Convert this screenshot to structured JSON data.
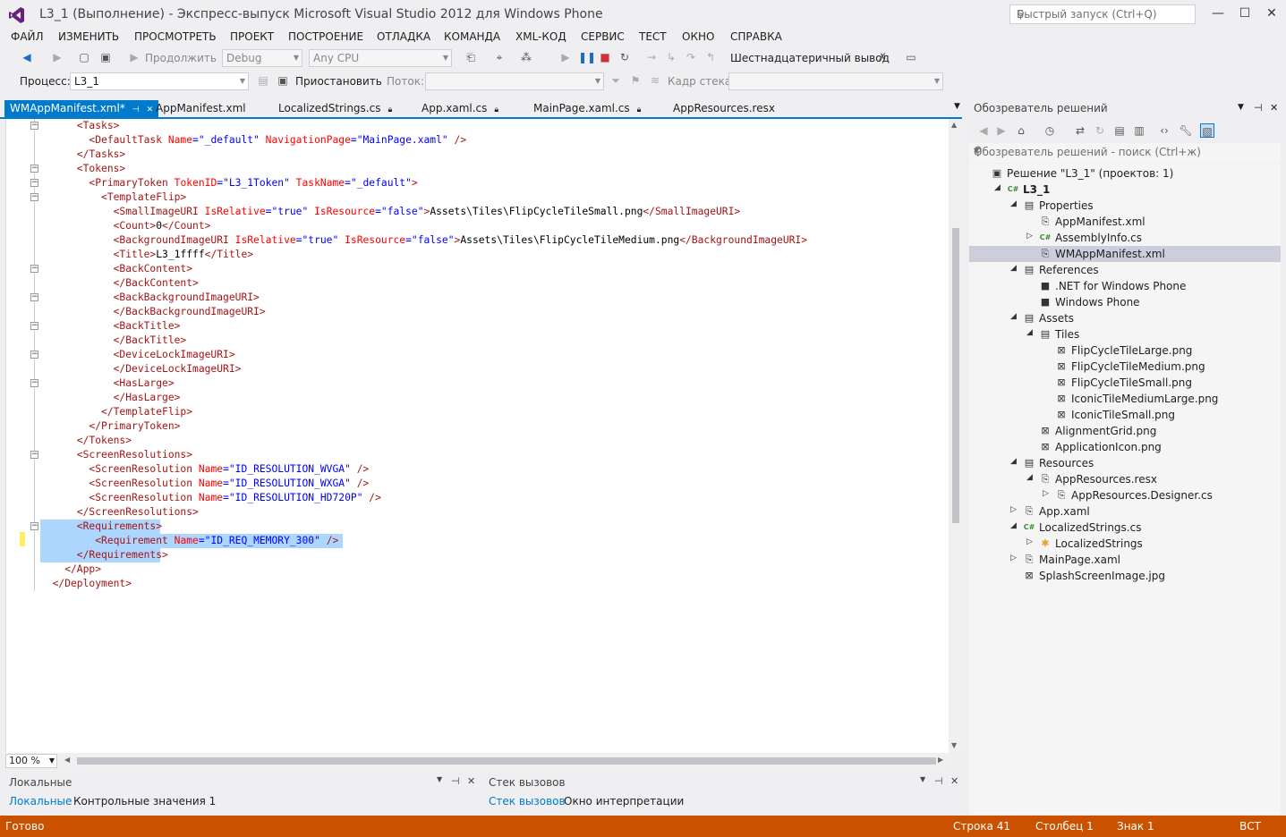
{
  "window": {
    "title": "L3_1 (Выполнение) - Экспресс-выпуск Microsoft Visual Studio 2012 для Windows Phone",
    "quick_launch_placeholder": "Быстрый запуск (Ctrl+Q)"
  },
  "menu": [
    "ФАЙЛ",
    "ИЗМЕНИТЬ",
    "ПРОСМОТРЕТЬ",
    "ПРОЕКТ",
    "ПОСТРОЕНИЕ",
    "ОТЛАДКА",
    "КОМАНДА",
    "XML-КОД",
    "СЕРВИС",
    "ТЕСТ",
    "ОКНО",
    "СПРАВКА"
  ],
  "toolbar": {
    "continue_label": "Продолжить",
    "config": "Debug",
    "platform": "Any CPU",
    "hex_label": "Шестнадцатеричный вывод",
    "process_label": "Процесс:",
    "process_value": "L3_1",
    "suspend_label": "Приостановить",
    "thread_label": "Поток:",
    "stack_frame_label": "Кадр стека:"
  },
  "tabs": [
    {
      "label": "WMAppManifest.xml*"
    },
    {
      "label": "AppManifest.xml"
    },
    {
      "label": "LocalizedStrings.cs"
    },
    {
      "label": "App.xaml.cs"
    },
    {
      "label": "MainPage.xaml.cs"
    },
    {
      "label": "AppResources.resx"
    }
  ],
  "editor": {
    "zoom": "100 %",
    "lines": [
      [
        [
          "t",
          "      <Tasks>"
        ]
      ],
      [
        [
          "t",
          "        <DefaultTask "
        ],
        [
          "a",
          "Name"
        ],
        [
          "b",
          "=\"_default\" "
        ],
        [
          "a",
          "NavigationPage"
        ],
        [
          "b",
          "=\"MainPage.xaml\" "
        ],
        [
          "t",
          "/>"
        ]
      ],
      [
        [
          "t",
          "      </Tasks>"
        ]
      ],
      [
        [
          "t",
          "      <Tokens>"
        ]
      ],
      [
        [
          "t",
          "        <PrimaryToken "
        ],
        [
          "a",
          "TokenID"
        ],
        [
          "b",
          "=\"L3_1Token\" "
        ],
        [
          "a",
          "TaskName"
        ],
        [
          "b",
          "=\"_default\""
        ],
        [
          "t",
          ">"
        ]
      ],
      [
        [
          "t",
          "          <TemplateFlip>"
        ]
      ],
      [
        [
          "t",
          "            <SmallImageURI "
        ],
        [
          "a",
          "IsRelative"
        ],
        [
          "b",
          "=\"true\" "
        ],
        [
          "a",
          "IsResource"
        ],
        [
          "b",
          "=\"false\""
        ],
        [
          "t",
          ">"
        ],
        [
          "k",
          "Assets\\Tiles\\FlipCycleTileSmall.png"
        ],
        [
          "t",
          "</SmallImageURI>"
        ]
      ],
      [
        [
          "t",
          "            <Count>"
        ],
        [
          "k",
          "0"
        ],
        [
          "t",
          "</Count>"
        ]
      ],
      [
        [
          "t",
          "            <BackgroundImageURI "
        ],
        [
          "a",
          "IsRelative"
        ],
        [
          "b",
          "=\"true\" "
        ],
        [
          "a",
          "IsResource"
        ],
        [
          "b",
          "=\"false\""
        ],
        [
          "t",
          ">"
        ],
        [
          "k",
          "Assets\\Tiles\\FlipCycleTileMedium.png"
        ],
        [
          "t",
          "</BackgroundImageURI>"
        ]
      ],
      [
        [
          "t",
          "            <Title>"
        ],
        [
          "k",
          "L3_1ffff"
        ],
        [
          "t",
          "</Title>"
        ]
      ],
      [
        [
          "t",
          "            <BackContent>"
        ]
      ],
      [
        [
          "t",
          "            </BackContent>"
        ]
      ],
      [
        [
          "t",
          "            <BackBackgroundImageURI>"
        ]
      ],
      [
        [
          "t",
          "            </BackBackgroundImageURI>"
        ]
      ],
      [
        [
          "t",
          "            <BackTitle>"
        ]
      ],
      [
        [
          "t",
          "            </BackTitle>"
        ]
      ],
      [
        [
          "t",
          "            <DeviceLockImageURI>"
        ]
      ],
      [
        [
          "t",
          "            </DeviceLockImageURI>"
        ]
      ],
      [
        [
          "t",
          "            <HasLarge>"
        ]
      ],
      [
        [
          "t",
          "            </HasLarge>"
        ]
      ],
      [
        [
          "t",
          "          </TemplateFlip>"
        ]
      ],
      [
        [
          "t",
          "        </PrimaryToken>"
        ]
      ],
      [
        [
          "t",
          "      </Tokens>"
        ]
      ],
      [
        [
          "t",
          "      <ScreenResolutions>"
        ]
      ],
      [
        [
          "t",
          "        <ScreenResolution "
        ],
        [
          "a",
          "Name"
        ],
        [
          "b",
          "=\"ID_RESOLUTION_WVGA\" "
        ],
        [
          "t",
          "/>"
        ]
      ],
      [
        [
          "t",
          "        <ScreenResolution "
        ],
        [
          "a",
          "Name"
        ],
        [
          "b",
          "=\"ID_RESOLUTION_WXGA\" "
        ],
        [
          "t",
          "/>"
        ]
      ],
      [
        [
          "t",
          "        <ScreenResolution "
        ],
        [
          "a",
          "Name"
        ],
        [
          "b",
          "=\"ID_RESOLUTION_HD720P\" "
        ],
        [
          "t",
          "/>"
        ]
      ],
      [
        [
          "t",
          "      </ScreenResolutions>"
        ]
      ],
      [
        [
          "t",
          "      <Requirements>"
        ]
      ],
      [
        [
          "t",
          "         <Requirement "
        ],
        [
          "a",
          "Name"
        ],
        [
          "b",
          "=\"ID_REQ_MEMORY_300\" "
        ],
        [
          "t",
          "/>"
        ]
      ],
      [
        [
          "t",
          "      </Requirements>"
        ]
      ],
      [
        [
          "t",
          "    </App>"
        ]
      ],
      [
        [
          "t",
          "  </Deployment>"
        ]
      ]
    ]
  },
  "solution_explorer": {
    "title": "Обозреватель решений",
    "search_placeholder": "Обозреватель решений - поиск (Ctrl+ж)",
    "nodes": [
      {
        "label": "Решение \"L3_1\"  (проектов: 1)",
        "depth": 0,
        "exp": "",
        "icon": "▣"
      },
      {
        "label": "L3_1",
        "depth": 1,
        "exp": "◢",
        "icon": "C#",
        "bold": true
      },
      {
        "label": "Properties",
        "depth": 2,
        "exp": "◢",
        "icon": "▤"
      },
      {
        "label": "AppManifest.xml",
        "depth": 3,
        "exp": "",
        "icon": "⎘"
      },
      {
        "label": "AssemblyInfo.cs",
        "depth": 3,
        "exp": "▷",
        "icon": "C#"
      },
      {
        "label": "WMAppManifest.xml",
        "depth": 3,
        "exp": "",
        "icon": "⎘",
        "selected": true
      },
      {
        "label": "References",
        "depth": 2,
        "exp": "◢",
        "icon": "▤"
      },
      {
        "label": ".NET for Windows Phone",
        "depth": 3,
        "exp": "",
        "icon": "■"
      },
      {
        "label": "Windows Phone",
        "depth": 3,
        "exp": "",
        "icon": "■"
      },
      {
        "label": "Assets",
        "depth": 2,
        "exp": "◢",
        "icon": "▤"
      },
      {
        "label": "Tiles",
        "depth": 3,
        "exp": "◢",
        "icon": "▤"
      },
      {
        "label": "FlipCycleTileLarge.png",
        "depth": 4,
        "exp": "",
        "icon": "⊠"
      },
      {
        "label": "FlipCycleTileMedium.png",
        "depth": 4,
        "exp": "",
        "icon": "⊠"
      },
      {
        "label": "FlipCycleTileSmall.png",
        "depth": 4,
        "exp": "",
        "icon": "⊠"
      },
      {
        "label": "IconicTileMediumLarge.png",
        "depth": 4,
        "exp": "",
        "icon": "⊠"
      },
      {
        "label": "IconicTileSmall.png",
        "depth": 4,
        "exp": "",
        "icon": "⊠"
      },
      {
        "label": "AlignmentGrid.png",
        "depth": 3,
        "exp": "",
        "icon": "⊠"
      },
      {
        "label": "ApplicationIcon.png",
        "depth": 3,
        "exp": "",
        "icon": "⊠"
      },
      {
        "label": "Resources",
        "depth": 2,
        "exp": "◢",
        "icon": "▤"
      },
      {
        "label": "AppResources.resx",
        "depth": 3,
        "exp": "◢",
        "icon": "⎘"
      },
      {
        "label": "AppResources.Designer.cs",
        "depth": 4,
        "exp": "▷",
        "icon": "⎘"
      },
      {
        "label": "App.xaml",
        "depth": 2,
        "exp": "▷",
        "icon": "⎘"
      },
      {
        "label": "LocalizedStrings.cs",
        "depth": 2,
        "exp": "◢",
        "icon": "C#"
      },
      {
        "label": "LocalizedStrings",
        "depth": 3,
        "exp": "▷",
        "icon": "✱"
      },
      {
        "label": "MainPage.xaml",
        "depth": 2,
        "exp": "▷",
        "icon": "⎘"
      },
      {
        "label": "SplashScreenImage.jpg",
        "depth": 2,
        "exp": "",
        "icon": "⊠"
      }
    ]
  },
  "panes": {
    "locals_title": "Локальные",
    "locals_tab": "Локальные",
    "watch_tab": "Контрольные значения 1",
    "callstack_title": "Стек вызовов",
    "callstack_tab": "Стек вызовов",
    "immediate_tab": "Окно интерпретации"
  },
  "status": {
    "ready": "Готово",
    "line": "Строка 41",
    "col": "Столбец 1",
    "ch": "Знак 1",
    "mode": "ВСТ"
  },
  "colors": {
    "accent": "#007ACC",
    "status": "#CA5100",
    "selection": "#ADD6FF"
  }
}
